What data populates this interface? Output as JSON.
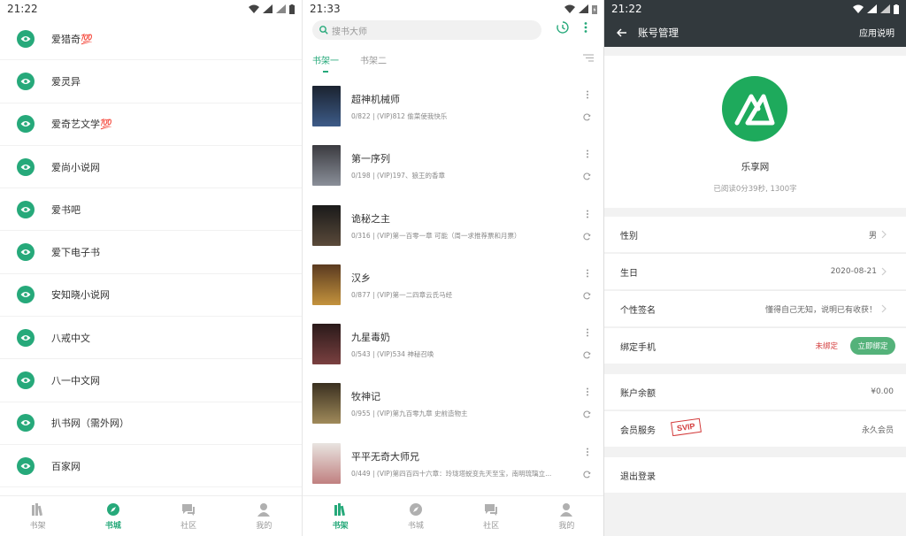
{
  "panel1": {
    "time": "21:22",
    "sources": [
      "爱猎奇💯",
      "爱灵异",
      "爱奇艺文学💯",
      "爱尚小说网",
      "爱书吧",
      "爱下电子书",
      "安知晓小说网",
      "八戒中文",
      "八一中文网",
      "扒书网（需外网）",
      "百家网"
    ],
    "tabs": [
      "书架",
      "书城",
      "社区",
      "我的"
    ],
    "active_tab": 1
  },
  "panel2": {
    "time": "21:33",
    "search_placeholder": "搜书大师",
    "shelf_tabs": [
      "书架一",
      "书架二"
    ],
    "books": [
      {
        "title": "超神机械师",
        "info": "0/822 | (VIP)812 偷菜使我快乐",
        "c1": "#1b2330",
        "c2": "#3d5b88"
      },
      {
        "title": "第一序列",
        "info": "0/198 | (VIP)197、狼王的香章",
        "c1": "#3b3b40",
        "c2": "#8a8f99"
      },
      {
        "title": "诡秘之主",
        "info": "0/316 | (VIP)第一百零一章 可能（周一求推荐票和月票）",
        "c1": "#1a1a1a",
        "c2": "#5a4a3a"
      },
      {
        "title": "汉乡",
        "info": "0/877 | (VIP)第一二四章云氏马经",
        "c1": "#5a3a20",
        "c2": "#c4933d"
      },
      {
        "title": "九星毒奶",
        "info": "0/543 | (VIP)534 神秘召唤",
        "c1": "#2a1a1a",
        "c2": "#7a4040"
      },
      {
        "title": "牧神记",
        "info": "0/955 | (VIP)第九百零九章 史前造物主",
        "c1": "#3a3020",
        "c2": "#a08a5a"
      },
      {
        "title": "平平无奇大师兄",
        "info": "0/449 | (VIP)第四百四十六章：玲珑塔蜕变先天至宝，南明琉璃立...",
        "c1": "#e8e4e0",
        "c2": "#c08080"
      }
    ],
    "tabs": [
      "书架",
      "书城",
      "社区",
      "我的"
    ],
    "active_tab": 0
  },
  "panel3": {
    "time": "21:22",
    "title": "账号管理",
    "help": "应用说明",
    "name": "乐享网",
    "stats": "已阅读0分39秒, 1300字",
    "rows": {
      "gender_label": "性别",
      "gender_value": "男",
      "birthday_label": "生日",
      "birthday_value": "2020-08-21",
      "sign_label": "个性签名",
      "sign_value": "懂得自己无知，说明已有收获！",
      "phone_label": "绑定手机",
      "phone_status": "未绑定",
      "phone_button": "立即绑定",
      "balance_label": "账户余额",
      "balance_value": "¥0.00",
      "member_label": "会员服务",
      "member_badge": "SVIP",
      "member_value": "永久会员",
      "logout_label": "退出登录"
    }
  },
  "colors": {
    "accent": "#26a97a",
    "header": "#32393d",
    "logo": "#1eaa5c",
    "danger": "#d33b3b"
  }
}
